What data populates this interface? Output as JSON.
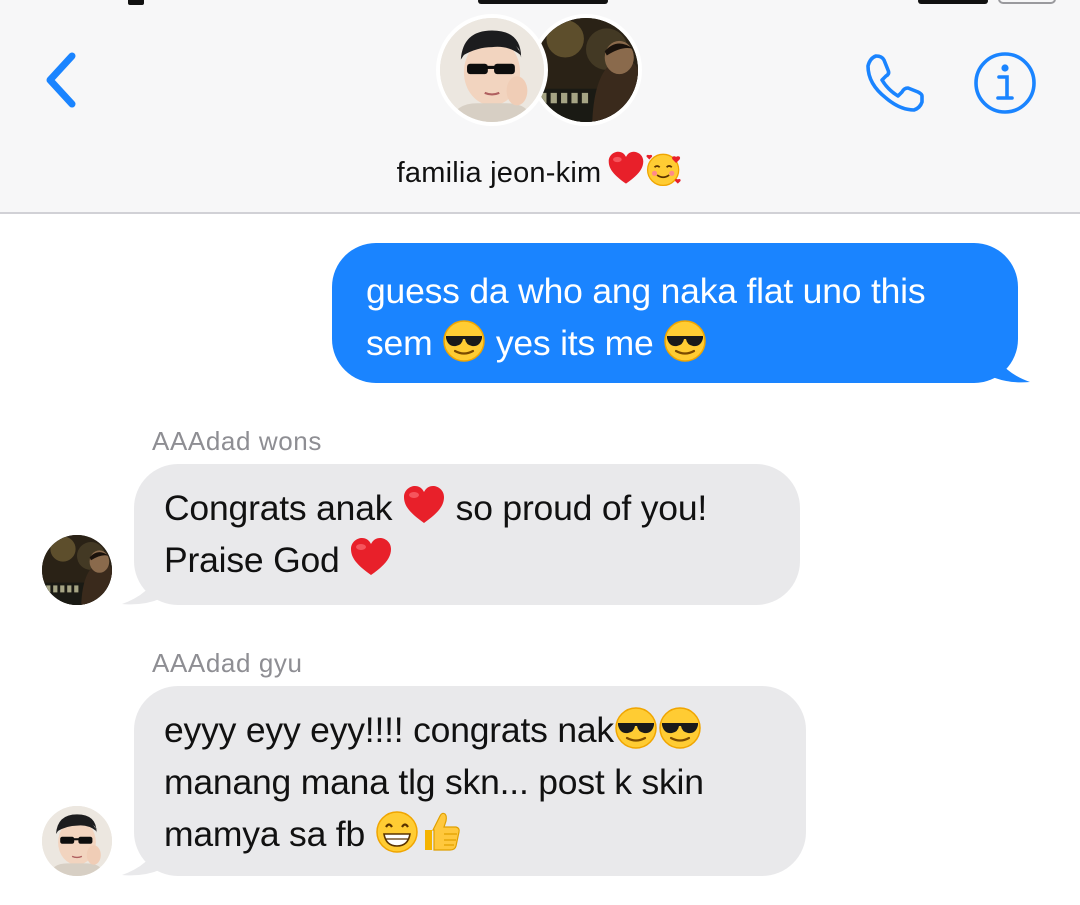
{
  "header": {
    "back_label": "",
    "group_name": "familia jeon-kim",
    "title_emojis": [
      "red-heart-emoji",
      "smiling-face-with-hearts-emoji"
    ],
    "actions": [
      "phone-icon",
      "info-icon"
    ],
    "accent_color": "#1a84ff"
  },
  "messages": [
    {
      "direction": "outgoing",
      "line1": "guess da who ang naka flat uno this",
      "line2_a": "sem",
      "line2_b": "yes its me",
      "emojis": [
        "sunglasses-emoji",
        "sunglasses-emoji"
      ]
    },
    {
      "direction": "incoming",
      "sender": "AAAdad wons",
      "line1_a": "Congrats anak",
      "line1_b": "so proud of you!",
      "line2_a": "Praise God",
      "emojis": [
        "red-heart-emoji",
        "red-heart-emoji"
      ]
    },
    {
      "direction": "incoming",
      "sender": "AAAdad gyu",
      "line1_a": "eyyy eyy eyy!!!! congrats nak",
      "line2": "manang mana tlg skn... post k skin",
      "line3_a": "mamya sa fb",
      "emojis": [
        "sunglasses-emoji",
        "sunglasses-emoji",
        "grinning-face-emoji",
        "thumbs-up-emoji"
      ]
    }
  ],
  "colors": {
    "outgoing_bubble": "#1a84ff",
    "incoming_bubble": "#e9e9eb",
    "sender_text": "#8e8e93",
    "header_bg": "#f7f7f8"
  }
}
